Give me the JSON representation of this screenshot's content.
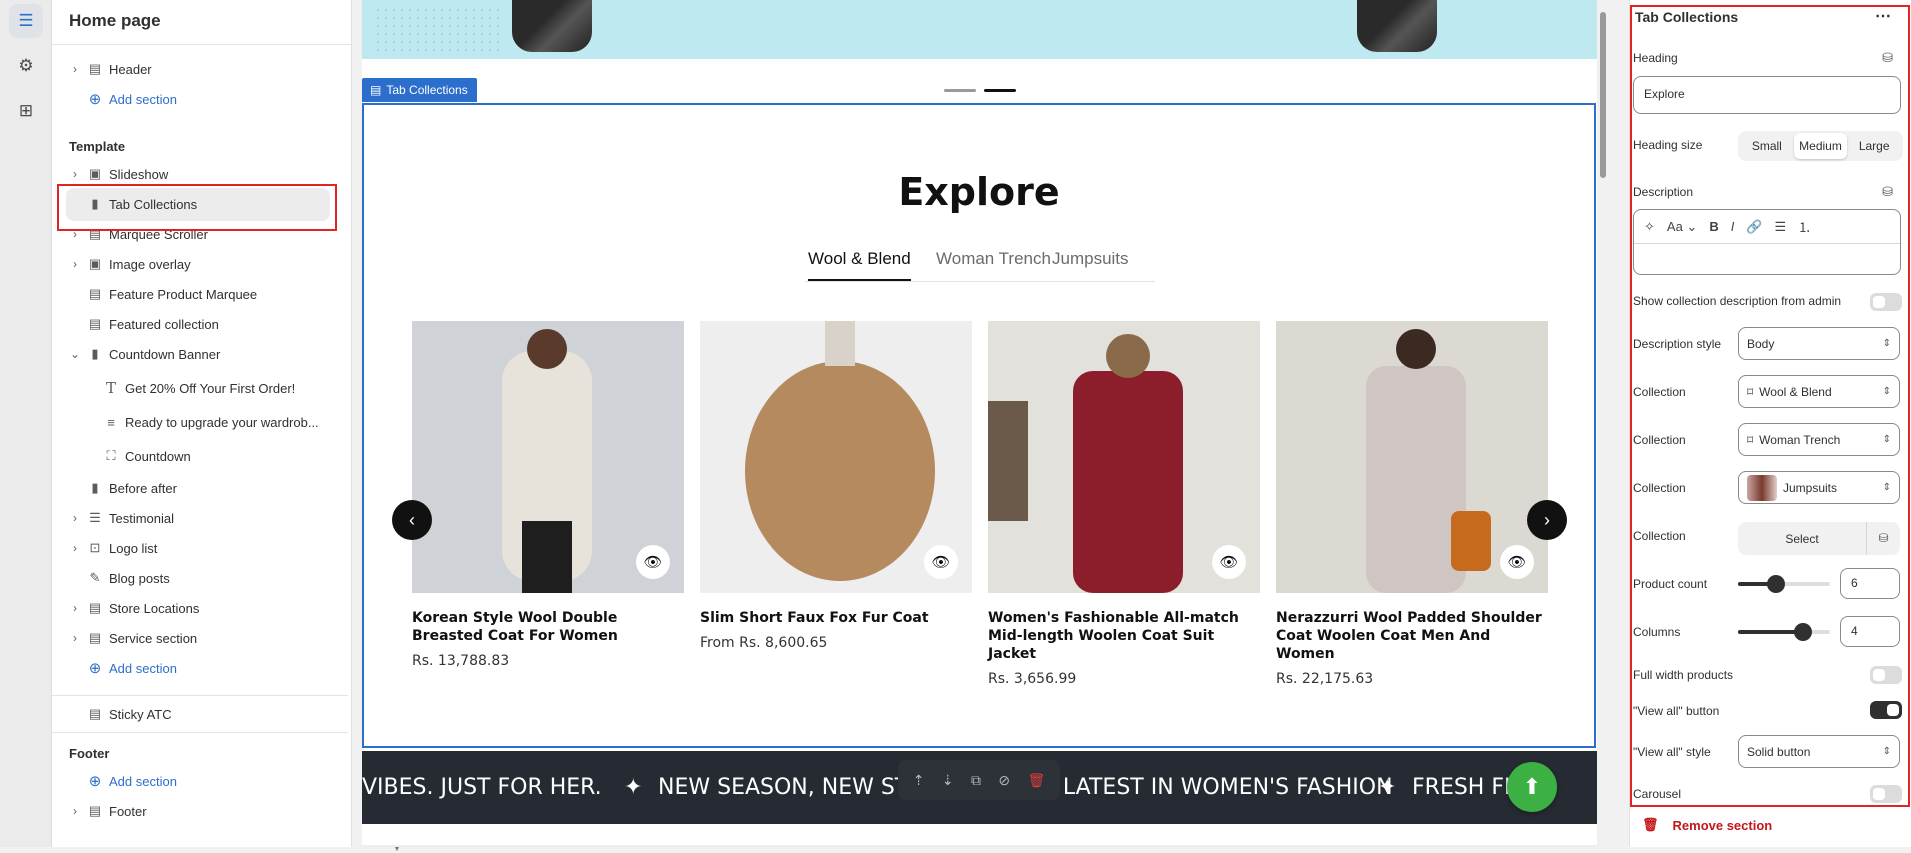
{
  "sidebar": {
    "title": "Home page",
    "header_section": "Header",
    "add_section": "Add section",
    "template_label": "Template",
    "template_items": [
      {
        "label": "Slideshow"
      },
      {
        "label": "Tab Collections"
      },
      {
        "label": "Marquee Scroller"
      },
      {
        "label": "Image overlay"
      },
      {
        "label": "Feature Product Marquee"
      },
      {
        "label": "Featured collection"
      },
      {
        "label": "Countdown Banner"
      },
      {
        "label": "Get 20% Off Your First Order!"
      },
      {
        "label": "Ready to upgrade your wardrob..."
      },
      {
        "label": "Countdown"
      },
      {
        "label": "Before after"
      },
      {
        "label": "Testimonial"
      },
      {
        "label": "Logo list"
      },
      {
        "label": "Blog posts"
      },
      {
        "label": "Store Locations"
      },
      {
        "label": "Service section"
      }
    ],
    "sticky": "Sticky ATC",
    "footer_label": "Footer",
    "footer_section": "Footer"
  },
  "preview": {
    "section_tag": "Tab Collections",
    "heading": "Explore",
    "tabs": [
      "Wool & Blend",
      "Woman Trench",
      "Jumpsuits"
    ],
    "products": [
      {
        "name": "Korean Style Wool Double Breasted Coat For Women",
        "price": "Rs. 13,788.83",
        "color": "#e7e3da",
        "bg": "#cfd2d6"
      },
      {
        "name": "Slim Short Faux Fox Fur Coat",
        "price": "From Rs. 8,600.65",
        "color": "#b58a5e",
        "bg": "#eeeeee"
      },
      {
        "name": "Women's Fashionable All-match Mid-length Woolen Coat Suit Jacket",
        "price": "Rs. 3,656.99",
        "color": "#8c1d2a",
        "bg": "#e3e1dc"
      },
      {
        "name": "Nerazzurri Wool Padded Shoulder Coat Woolen Coat Men And Women",
        "price": "Rs. 22,175.63",
        "color": "#cfc6c4",
        "bg": "#dcd9d3"
      }
    ],
    "marquee": [
      "VIBES. JUST FOR HER.",
      "NEW SEASON, NEW STY",
      "THE LATEST IN WOMEN'S FASHION",
      "FRESH FIT"
    ]
  },
  "panel": {
    "title": "Tab Collections",
    "heading_label": "Heading",
    "heading_value": "Explore",
    "heading_size_label": "Heading size",
    "size_options": [
      "Small",
      "Medium",
      "Large"
    ],
    "description_label": "Description",
    "show_desc_label": "Show collection description from admin",
    "desc_style_label": "Description style",
    "desc_style_value": "Body",
    "collection_label": "Collection",
    "collections": [
      "Wool & Blend",
      "Woman Trench",
      "Jumpsuits"
    ],
    "select_label": "Select",
    "product_count_label": "Product count",
    "product_count": "6",
    "columns_label": "Columns",
    "columns": "4",
    "full_width_label": "Full width products",
    "view_all_label": "\"View all\" button",
    "view_all_style_label": "\"View all\" style",
    "view_all_style_value": "Solid button",
    "carousel_label": "Carousel",
    "remove_label": "Remove section"
  },
  "colors": {
    "accent": "#2c6ecb",
    "danger": "#c4161c",
    "marquee_bg": "#262b33",
    "fab": "#3cb043"
  }
}
